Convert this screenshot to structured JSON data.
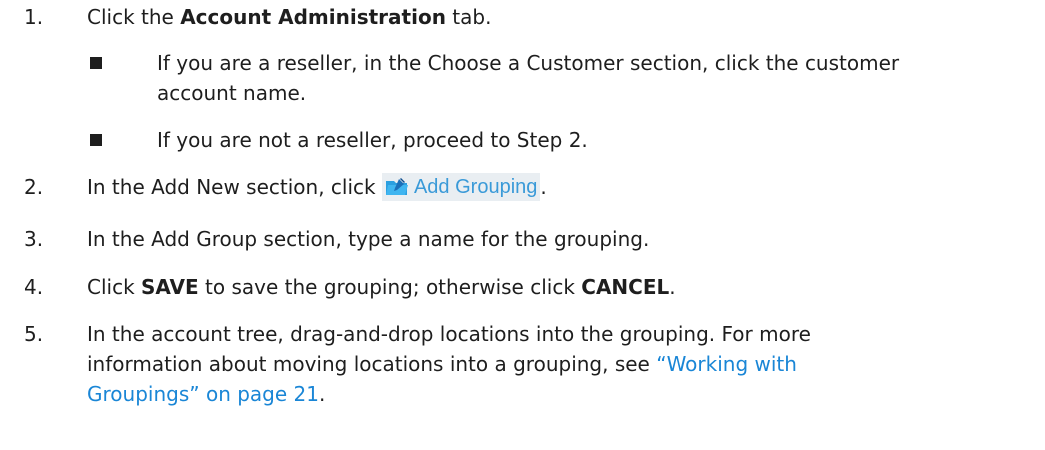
{
  "steps": [
    {
      "num": "1.",
      "pre": "Click the ",
      "bold": "Account Administration",
      "post": " tab."
    },
    {
      "num": "2.",
      "pre": "In the Add New section, click ",
      "button": "Add Grouping",
      "post": "."
    },
    {
      "num": "3.",
      "text": "In the Add Group section, type a name for the grouping."
    },
    {
      "num": "4.",
      "pre": "Click ",
      "bold1": "SAVE",
      "mid": " to save the grouping; otherwise click ",
      "bold2": "CANCEL",
      "post": "."
    },
    {
      "num": "5.",
      "line1": "In the account tree, drag-and-drop locations into the grouping. For more",
      "line2_pre": "information about moving locations into a grouping, see ",
      "link_part1": "“Working with",
      "link_part2": "Groupings” on page 21",
      "post": "."
    }
  ],
  "bullets": [
    {
      "line1": "If you are a reseller, in the Choose a Customer section, click the customer",
      "line2": "account name."
    },
    {
      "line1": "If you are not a reseller, proceed to Step 2."
    }
  ],
  "colors": {
    "link": "#1a86d6",
    "button_text": "#3a9ad8",
    "button_bg": "#e9eef2"
  },
  "icons": {
    "add_grouping": "folder-add-icon"
  }
}
